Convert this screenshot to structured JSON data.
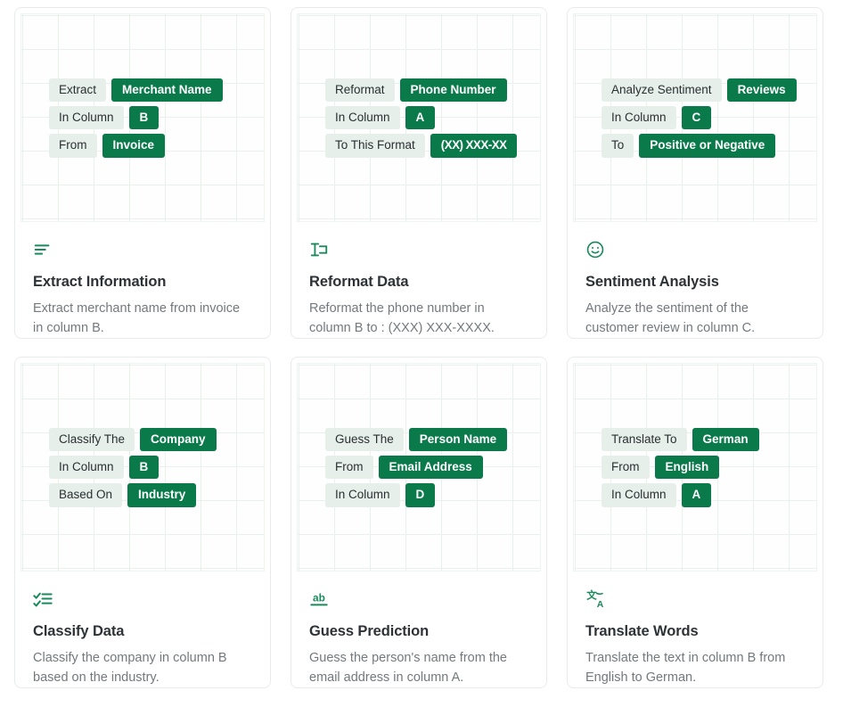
{
  "cards": [
    {
      "icon": "align-left-icon",
      "title": "Extract Information",
      "description": "Extract merchant name from invoice in column B.",
      "rows": [
        {
          "label": "Extract",
          "value": "Merchant Name"
        },
        {
          "label": "In Column",
          "value": "B"
        },
        {
          "label": "From",
          "value": "Invoice"
        }
      ]
    },
    {
      "icon": "text-format-icon",
      "title": "Reformat Data",
      "description": "Reformat the phone number in column B to : (XXX) XXX-XXXX.",
      "rows": [
        {
          "label": "Reformat",
          "value": "Phone Number"
        },
        {
          "label": "In Column",
          "value": "A"
        },
        {
          "label": "To This Format",
          "value": "(XX) XXX-XX",
          "compact": true
        }
      ]
    },
    {
      "icon": "smiley-face-icon",
      "title": "Sentiment Analysis",
      "description": "Analyze the sentiment of the customer review in column C.",
      "rows": [
        {
          "label": "Analyze Sentiment",
          "value": "Reviews"
        },
        {
          "label": "In Column",
          "value": "C"
        },
        {
          "label": "To",
          "value": "Positive or Negative"
        }
      ]
    },
    {
      "icon": "checklist-icon",
      "title": "Classify Data",
      "description": "Classify the company in column B based on the industry.",
      "rows": [
        {
          "label": "Classify The",
          "value": "Company"
        },
        {
          "label": "In Column",
          "value": "B"
        },
        {
          "label": "Based On",
          "value": "Industry"
        }
      ]
    },
    {
      "icon": "spellcheck-ab-icon",
      "title": "Guess Prediction",
      "description": "Guess the person's name from the email address in column A.",
      "rows": [
        {
          "label": "Guess The",
          "value": "Person Name"
        },
        {
          "label": "From",
          "value": "Email Address"
        },
        {
          "label": "In Column",
          "value": "D"
        }
      ]
    },
    {
      "icon": "translate-icon",
      "title": "Translate Words",
      "description": "Translate the text in column B from English to German.",
      "rows": [
        {
          "label": "Translate To",
          "value": "German"
        },
        {
          "label": "From",
          "value": "English"
        },
        {
          "label": "In Column",
          "value": "A"
        }
      ]
    }
  ],
  "colors": {
    "accent_green": "#0b7a4b",
    "icon_green": "#1a8a5c",
    "pill_label_bg": "#e6efe9",
    "title_text": "#2d3237",
    "desc_text": "#74797e",
    "card_border": "#e8eaec",
    "grid_line": "#e9f1ec"
  }
}
